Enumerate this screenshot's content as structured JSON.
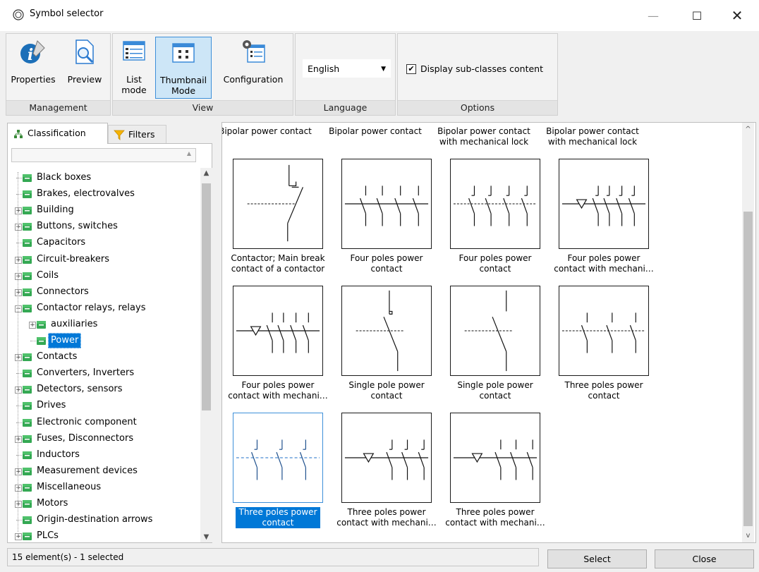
{
  "window": {
    "title": "Symbol selector",
    "minimize_glyph": "—",
    "maximize_glyph": "☐",
    "close_glyph": "✕"
  },
  "ribbon": {
    "groups": {
      "management": "Management",
      "view": "View",
      "language": "Language",
      "options": "Options"
    },
    "buttons": {
      "properties": "Properties",
      "preview": "Preview",
      "list_mode_line1": "List",
      "list_mode_line2": "mode",
      "thumbnail_line1": "Thumbnail",
      "thumbnail_line2": "Mode",
      "configuration": "Configuration"
    },
    "language_value": "English",
    "display_subclasses_label": "Display sub-classes content",
    "display_subclasses_checked": true
  },
  "left_tabs": {
    "classification": "Classification",
    "filters": "Filters"
  },
  "tree": [
    {
      "label": "Black boxes",
      "expandable": false,
      "level": 0
    },
    {
      "label": "Brakes, electrovalves",
      "expandable": false,
      "level": 0
    },
    {
      "label": "Building",
      "expandable": true,
      "level": 0
    },
    {
      "label": "Buttons, switches",
      "expandable": true,
      "level": 0
    },
    {
      "label": "Capacitors",
      "expandable": false,
      "level": 0
    },
    {
      "label": "Circuit-breakers",
      "expandable": true,
      "level": 0
    },
    {
      "label": "Coils",
      "expandable": true,
      "level": 0
    },
    {
      "label": "Connectors",
      "expandable": true,
      "level": 0
    },
    {
      "label": "Contactor relays, relays",
      "expandable": true,
      "expanded": true,
      "level": 0
    },
    {
      "label": "auxiliaries",
      "expandable": true,
      "level": 1
    },
    {
      "label": "Power",
      "expandable": false,
      "level": 1,
      "selected": true
    },
    {
      "label": "Contacts",
      "expandable": true,
      "level": 0
    },
    {
      "label": "Converters, Inverters",
      "expandable": false,
      "level": 0
    },
    {
      "label": "Detectors, sensors",
      "expandable": true,
      "level": 0
    },
    {
      "label": "Drives",
      "expandable": false,
      "level": 0
    },
    {
      "label": "Electronic component",
      "expandable": false,
      "level": 0
    },
    {
      "label": "Fuses, Disconnectors",
      "expandable": true,
      "level": 0
    },
    {
      "label": "Inductors",
      "expandable": false,
      "level": 0
    },
    {
      "label": "Measurement devices",
      "expandable": true,
      "level": 0
    },
    {
      "label": "Miscellaneous",
      "expandable": true,
      "level": 0
    },
    {
      "label": "Motors",
      "expandable": true,
      "level": 0
    },
    {
      "label": "Origin-destination arrows",
      "expandable": false,
      "level": 0
    },
    {
      "label": "PLCs",
      "expandable": true,
      "level": 0
    }
  ],
  "top_captions": [
    {
      "line1": "Bipolar power contact",
      "line2": ""
    },
    {
      "line1": "Bipolar power contact",
      "line2": ""
    },
    {
      "line1": "Bipolar power contact",
      "line2": "with mechanical lock"
    },
    {
      "line1": "Bipolar power contact",
      "line2": "with mechanical lock"
    }
  ],
  "symbols": [
    {
      "line1": "Contactor; Main break",
      "line2": "contact of a contactor",
      "selected": false
    },
    {
      "line1": "Four poles power",
      "line2": "contact",
      "selected": false
    },
    {
      "line1": "Four poles power",
      "line2": "contact",
      "selected": false
    },
    {
      "line1": "Four poles power",
      "line2": "contact with mechani…",
      "selected": false
    },
    {
      "line1": "Four poles power",
      "line2": "contact with mechani…",
      "selected": false
    },
    {
      "line1": "Single pole power",
      "line2": "contact",
      "selected": false
    },
    {
      "line1": "Single pole power",
      "line2": "contact",
      "selected": false
    },
    {
      "line1": "Three poles power",
      "line2": "contact",
      "selected": false
    },
    {
      "line1": "Three poles power",
      "line2": "contact",
      "selected": true
    },
    {
      "line1": "Three poles power",
      "line2": "contact with mechani…",
      "selected": false
    },
    {
      "line1": "Three poles power",
      "line2": "contact with mechani…",
      "selected": false
    }
  ],
  "status_text": "15 element(s) - 1 selected",
  "buttons": {
    "select": "Select",
    "close": "Close"
  }
}
